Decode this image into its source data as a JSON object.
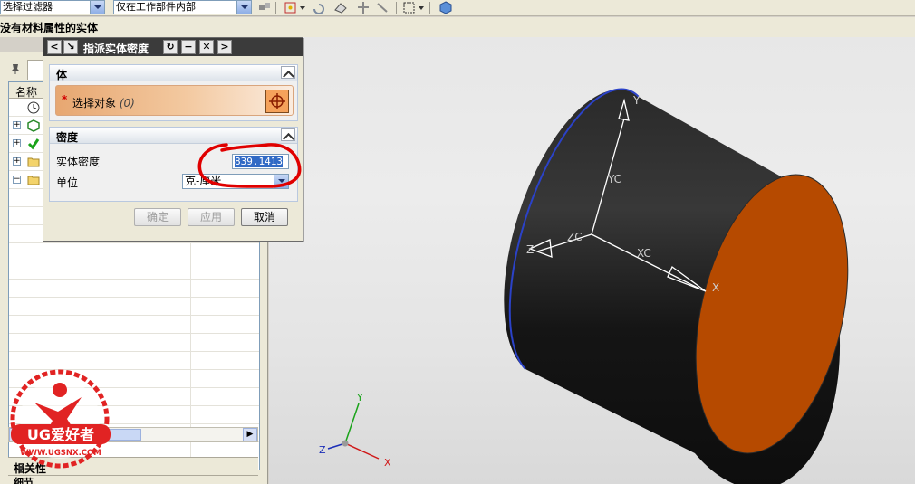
{
  "toolbar": {
    "filter_value": "选择过滤器",
    "scope_value": "仅在工作部件内部"
  },
  "status": {
    "message": "没有材料属性的实体"
  },
  "navigator": {
    "column_name": "名称",
    "panel_related": "相关性",
    "panel_details": "细节"
  },
  "dialog": {
    "title": "指派实体密度",
    "group_body": "体",
    "select_object_label": "选择对象",
    "select_object_count": "(0)",
    "group_density": "密度",
    "density_label": "实体密度",
    "density_value": "839.1413",
    "unit_label": "单位",
    "unit_value": "克-厘米",
    "ok_label": "确定",
    "apply_label": "应用",
    "cancel_label": "取消"
  },
  "graphics": {
    "wcs_y": "YC",
    "wcs_z": "ZC",
    "wcs_x": "XC",
    "axis_y": "Y",
    "axis_z": "Z",
    "axis_x": "X",
    "triad_y": "Y",
    "triad_z": "Z",
    "triad_x": "X",
    "cylinder_color": "#1c1c1c",
    "face_color": "#b64a00"
  },
  "watermark": {
    "brand": "UG爱好者",
    "url": "WWW.UGSNX.COM"
  },
  "colors": {
    "annotation": "#e00000",
    "accent_orange": "#f5a25b"
  }
}
